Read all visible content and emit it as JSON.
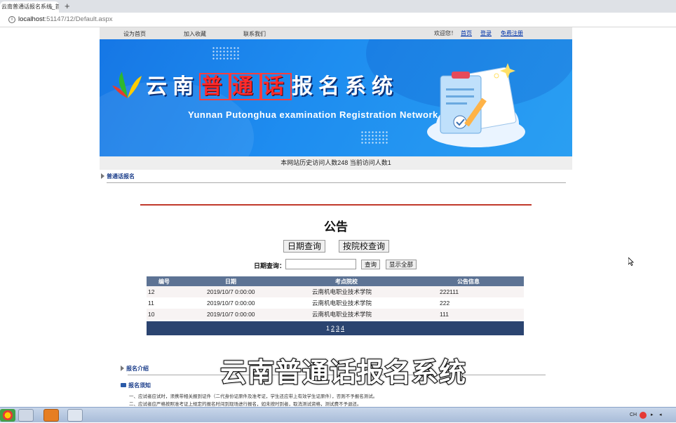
{
  "browser": {
    "tab_title": "云南普通话报名系统_首页",
    "tab_close": "×",
    "new_tab": "+",
    "url_host": "localhost",
    "url_path": ":51147/12/Default.aspx"
  },
  "topnav": {
    "left_links": [
      "设为首页",
      "加入收藏",
      "联系我们"
    ],
    "welcome": "欢迎您！",
    "right_links": [
      "首页",
      "登录",
      "免费注册"
    ]
  },
  "banner": {
    "title_pre": "云南",
    "title_hl1": "普",
    "title_hl2": "通",
    "title_hl3": "话",
    "title_post": "报名系统",
    "subtitle": "Yunnan Putonghua examination Registration Network"
  },
  "visits": {
    "text": "本网站历史访问人数248    当前访问人数1"
  },
  "section1": {
    "label": "普通话报名"
  },
  "notice": {
    "title": "公告",
    "btn_date": "日期查询",
    "btn_school": "按院校查询",
    "query_label": "日期查询：",
    "query_value": "",
    "btn_query": "查询",
    "btn_show_all": "显示全部"
  },
  "table": {
    "columns": [
      "编号",
      "日期",
      "考点院校",
      "公告信息"
    ],
    "rows": [
      [
        "12",
        "2019/10/7 0:00:00",
        "云南机电职业技术学院",
        "222111"
      ],
      [
        "11",
        "2019/10/7 0:00:00",
        "云南机电职业技术学院",
        "222"
      ],
      [
        "10",
        "2019/10/7 0:00:00",
        "云南机电职业技术学院",
        "111"
      ]
    ],
    "pages": [
      "1",
      "2",
      "3",
      "4"
    ]
  },
  "section2": {
    "label": "报名介绍"
  },
  "rules": {
    "heading": "报名须知",
    "lines": [
      "一、应试者应试时，须携带相关报到证件（二代身份证原件及准考证，学生还应带上有效学生证原件），否则不予报名测试。",
      "二、应试者应严格按照准考证上规定的报名时间到现场进行报名，如未按时到者，取消测试资格，测试费不予退还。"
    ]
  },
  "overlay_caption": "云南普通话报名系统",
  "colors": {
    "banner": "#1e8df0",
    "table_header": "#5d7394",
    "pager": "#2b4470",
    "red_line": "#c0392b",
    "highlight_red": "#ff2b2b"
  }
}
